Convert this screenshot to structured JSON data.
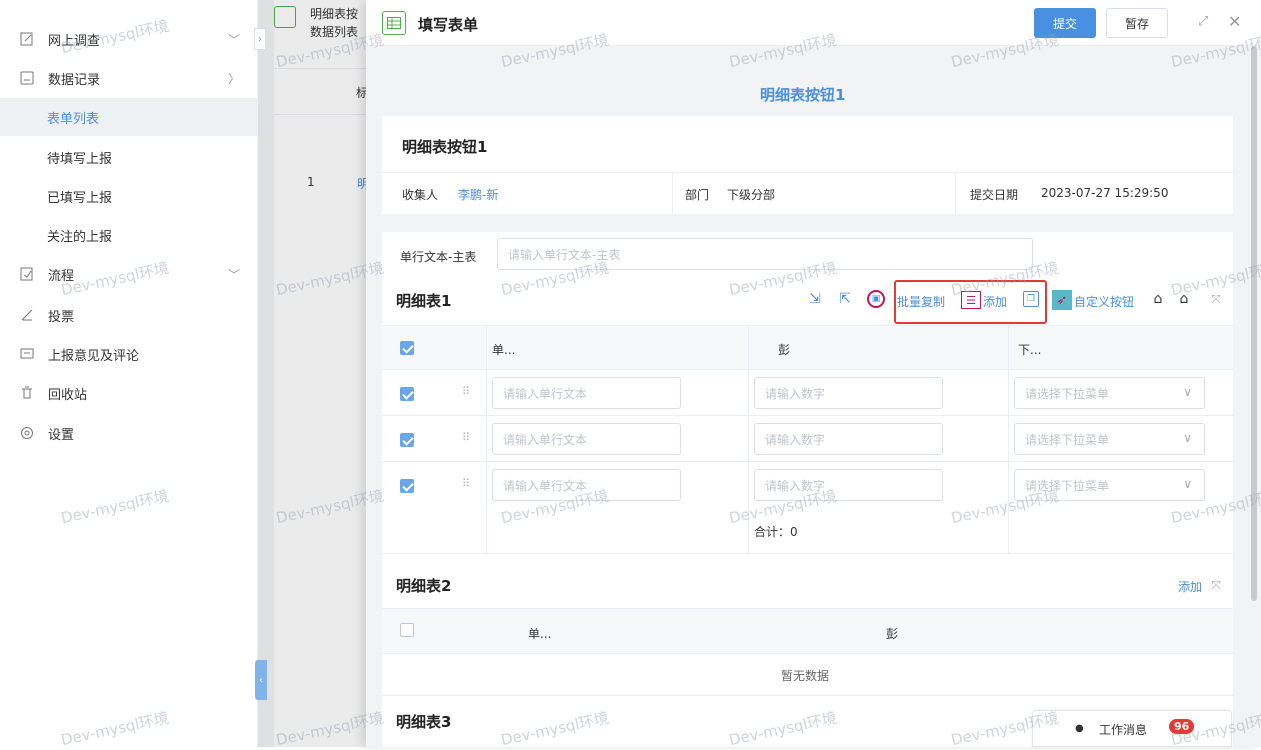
{
  "watermark": "Dev-mysql环境",
  "sidebar": {
    "items": [
      {
        "label": "网上调查",
        "icon": "edit-icon",
        "arrow": "﹀"
      },
      {
        "label": "数据记录",
        "icon": "record-icon",
        "arrow": "〉"
      },
      {
        "label": "流程",
        "icon": "flow-icon",
        "arrow": "﹀"
      },
      {
        "label": "投票",
        "icon": "vote-icon"
      },
      {
        "label": "上报意见及评论",
        "icon": "comment-icon"
      },
      {
        "label": "回收站",
        "icon": "trash-icon"
      },
      {
        "label": "设置",
        "icon": "settings-icon"
      }
    ],
    "subitems": [
      {
        "label": "表单列表",
        "active": true
      },
      {
        "label": "待填写上报"
      },
      {
        "label": "已填写上报"
      },
      {
        "label": "关注的上报"
      }
    ]
  },
  "behind": {
    "title1": "明细表按",
    "title2": "数据列表",
    "col": "标",
    "row_num": "1",
    "row_text": "明"
  },
  "drawer": {
    "title": "填写表单",
    "submit_label": "提交",
    "save_label": "暂存",
    "form_title": "明细表按钮1",
    "card_title": "明细表按钮1",
    "collector_label": "收集人",
    "collector_value": "李鹏-新",
    "dept_label": "部门",
    "dept_value": "下级分部",
    "date_label": "提交日期",
    "date_value": "2023-07-27 15:29:50",
    "main_text_label": "单行文本-主表",
    "main_text_placeholder": "请输入单行文本-主表"
  },
  "detail1": {
    "title": "明细表1",
    "toolbar": {
      "batch_copy": "批量复制",
      "add": "添加",
      "custom": "自定义按钮"
    },
    "columns": [
      "单...",
      "彭",
      "下..."
    ],
    "rows": [
      {
        "text_ph": "请输入单行文本",
        "num_ph": "请输入数字",
        "select_ph": "请选择下拉菜单"
      },
      {
        "text_ph": "请输入单行文本",
        "num_ph": "请输入数字",
        "select_ph": "请选择下拉菜单"
      },
      {
        "text_ph": "请输入单行文本",
        "num_ph": "请输入数字",
        "select_ph": "请选择下拉菜单"
      }
    ],
    "sum_label": "合计：0"
  },
  "detail2": {
    "title": "明细表2",
    "add": "添加",
    "columns": [
      "单...",
      "彭"
    ],
    "empty": "暂无数据"
  },
  "detail3": {
    "title": "明细表3"
  },
  "work_msg": {
    "label": "工作消息",
    "count": "96"
  },
  "colors": {
    "accent": "#4a90e2",
    "highlight": "#e53935",
    "badge": "#e53935"
  }
}
